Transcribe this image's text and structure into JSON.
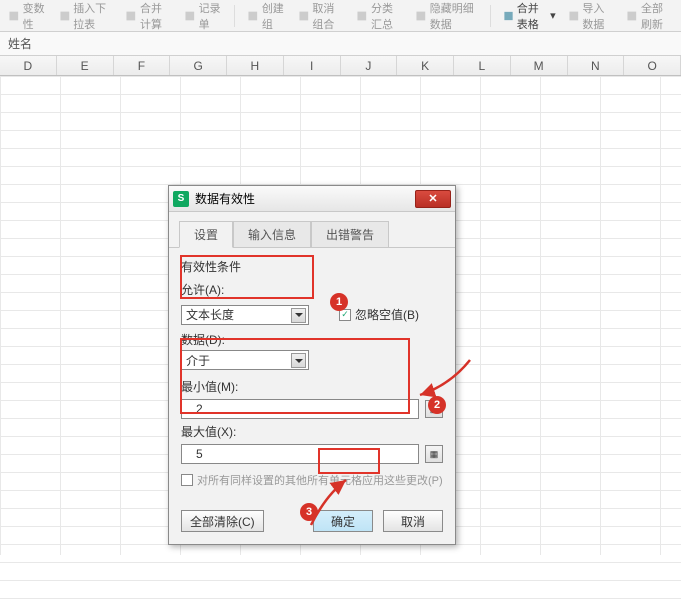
{
  "toolbar": {
    "items": [
      "变数性",
      "插入下拉表",
      "合并计算",
      "记录单",
      "创建组",
      "取消组合",
      "分类汇总",
      "隐藏明细数据",
      "合并表格",
      "导入数据",
      "全部刷新"
    ],
    "highlight": "合并表格"
  },
  "formula_bar": {
    "cell_label": "姓名"
  },
  "columns": [
    "D",
    "E",
    "F",
    "G",
    "H",
    "I",
    "J",
    "K",
    "L",
    "M",
    "N",
    "O"
  ],
  "dialog": {
    "title": "数据有效性",
    "tabs": [
      "设置",
      "输入信息",
      "出错警告"
    ],
    "active_tab": 0,
    "group_label": "有效性条件",
    "allow_label": "允许(A):",
    "allow_value": "文本长度",
    "ignore_blank_checked": true,
    "ignore_blank_label": "忽略空值(B)",
    "data_label": "数据(D):",
    "data_value": "介于",
    "min_label": "最小值(M):",
    "min_value": "2",
    "max_label": "最大值(X):",
    "max_value": "5",
    "apply_all_checked": false,
    "apply_all_label": "对所有同样设置的其他所有单元格应用这些更改(P)",
    "clear_btn": "全部清除(C)",
    "ok_btn": "确定",
    "cancel_btn": "取消"
  },
  "annotations": {
    "badge1": "1",
    "badge2": "2",
    "badge3": "3"
  }
}
